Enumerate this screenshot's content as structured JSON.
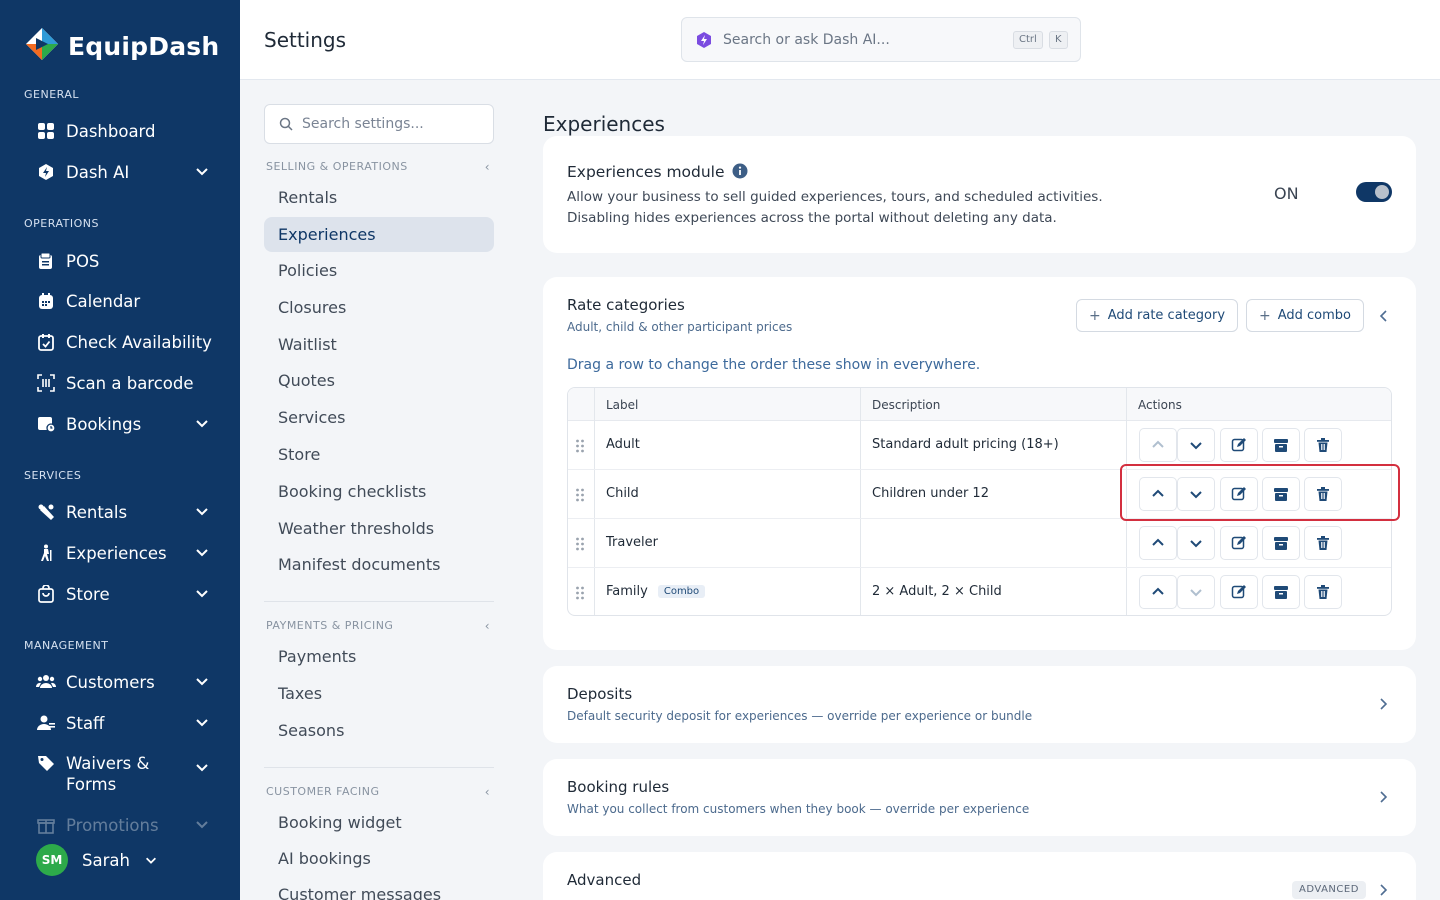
{
  "app": {
    "name": "EquipDash"
  },
  "colors": {
    "nav_bg": "#0f3766",
    "accent": "#0f3766",
    "highlight": "#d32f3f",
    "avatar_bg": "#2daa4a"
  },
  "nav": {
    "sections": {
      "general": "GENERAL",
      "operations": "OPERATIONS",
      "services": "SERVICES",
      "management": "MANAGEMENT"
    },
    "items": {
      "dashboard": "Dashboard",
      "dash_ai": "Dash AI",
      "pos": "POS",
      "calendar": "Calendar",
      "check_availability": "Check Availability",
      "scan_barcode": "Scan a barcode",
      "bookings": "Bookings",
      "rentals": "Rentals",
      "experiences": "Experiences",
      "store": "Store",
      "customers": "Customers",
      "staff": "Staff",
      "waivers": "Waivers & Forms",
      "promotions": "Promotions"
    },
    "user": {
      "initials": "SM",
      "name": "Sarah"
    }
  },
  "header": {
    "title": "Settings",
    "search_placeholder": "Search or ask Dash AI...",
    "shortcut": [
      "Ctrl",
      "K"
    ]
  },
  "settings_nav": {
    "search_placeholder": "Search settings...",
    "groups": [
      {
        "label": "SELLING & OPERATIONS",
        "items": [
          "Rentals",
          "Experiences",
          "Policies",
          "Closures",
          "Waitlist",
          "Quotes",
          "Services",
          "Store",
          "Booking checklists",
          "Weather thresholds",
          "Manifest documents"
        ]
      },
      {
        "label": "PAYMENTS & PRICING",
        "items": [
          "Payments",
          "Taxes",
          "Seasons"
        ]
      },
      {
        "label": "CUSTOMER FACING",
        "items": [
          "Booking widget",
          "AI bookings",
          "Customer messages"
        ]
      }
    ],
    "active": "Experiences"
  },
  "main": {
    "title": "Experiences",
    "module": {
      "title": "Experiences module",
      "desc_line1": "Allow your business to sell guided experiences, tours, and scheduled activities.",
      "desc_line2": "Disabling hides experiences across the portal without deleting any data.",
      "toggle_label": "ON",
      "enabled": true
    },
    "rate_categories": {
      "title": "Rate categories",
      "subtitle": "Adult, child & other participant prices",
      "add_rate_label": "Add rate category",
      "add_combo_label": "Add combo",
      "drag_hint": "Drag a row to change the order these show in everywhere.",
      "columns": [
        "Label",
        "Description",
        "Actions"
      ],
      "rows": [
        {
          "label": "Adult",
          "description": "Standard adult pricing (18+)",
          "badge": ""
        },
        {
          "label": "Child",
          "description": "Children under 12",
          "badge": ""
        },
        {
          "label": "Traveler",
          "description": "",
          "badge": ""
        },
        {
          "label": "Family",
          "description": "2 × Adult, 2 × Child",
          "badge": "Combo"
        }
      ]
    },
    "deposits": {
      "title": "Deposits",
      "subtitle": "Default security deposit for experiences — override per experience or bundle"
    },
    "booking_rules": {
      "title": "Booking rules",
      "subtitle": "What you collect from customers when they book — override per experience"
    },
    "advanced": {
      "title": "Advanced",
      "badge": "ADVANCED"
    }
  }
}
